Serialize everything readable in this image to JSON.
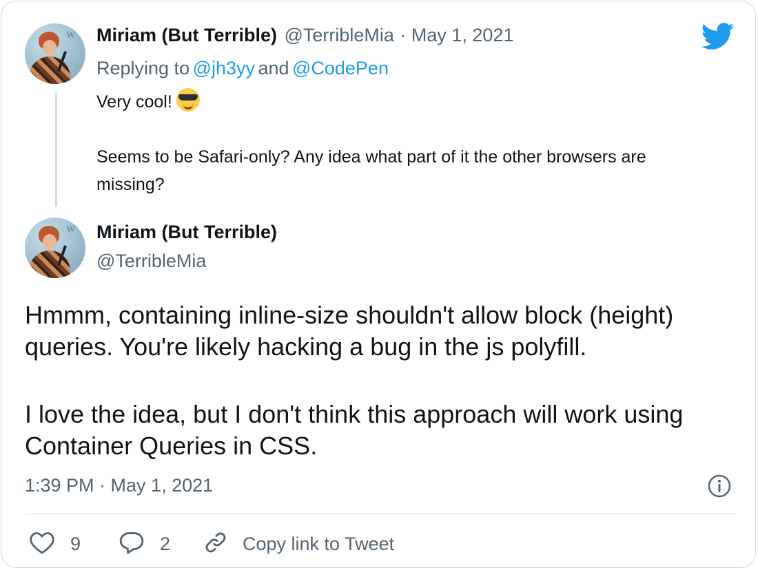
{
  "reply_tweet": {
    "author_name": "Miriam (But Terrible)",
    "handle": "@TerribleMia",
    "date": "· May 1, 2021",
    "replying_prefix": "Replying to",
    "replying_to_1": "@jh3yy",
    "replying_and": "and",
    "replying_to_2": "@CodePen",
    "text_line_1": "Very cool!",
    "emoji_name": "smiling-face-with-sunglasses",
    "text_line_2": "Seems to be Safari-only? Any idea what part of it the other browsers are",
    "text_line_3": "missing?"
  },
  "main_tweet": {
    "author_name": "Miriam (But Terrible)",
    "handle": "@TerribleMia",
    "paragraph_1_line_1": "Hmmm, containing inline-size shouldn't allow block (height)",
    "paragraph_1_line_2": "queries. You're likely hacking a bug in the js polyfill.",
    "paragraph_2_line_1": "I love the idea, but I don't think this approach will work using",
    "paragraph_2_line_2": "Container Queries in CSS.",
    "timestamp": "1:39 PM · May 1, 2021"
  },
  "actions": {
    "like_count": "9",
    "reply_count": "2",
    "copy_link_label": "Copy link to Tweet"
  },
  "colors": {
    "twitter_blue": "#1d9bf0",
    "muted_text": "#536471",
    "border": "#cfd9de"
  },
  "icons": {
    "brand": "twitter-bird-icon",
    "info": "info-icon",
    "like": "heart-icon",
    "reply": "reply-bubble-icon",
    "link": "link-icon"
  }
}
